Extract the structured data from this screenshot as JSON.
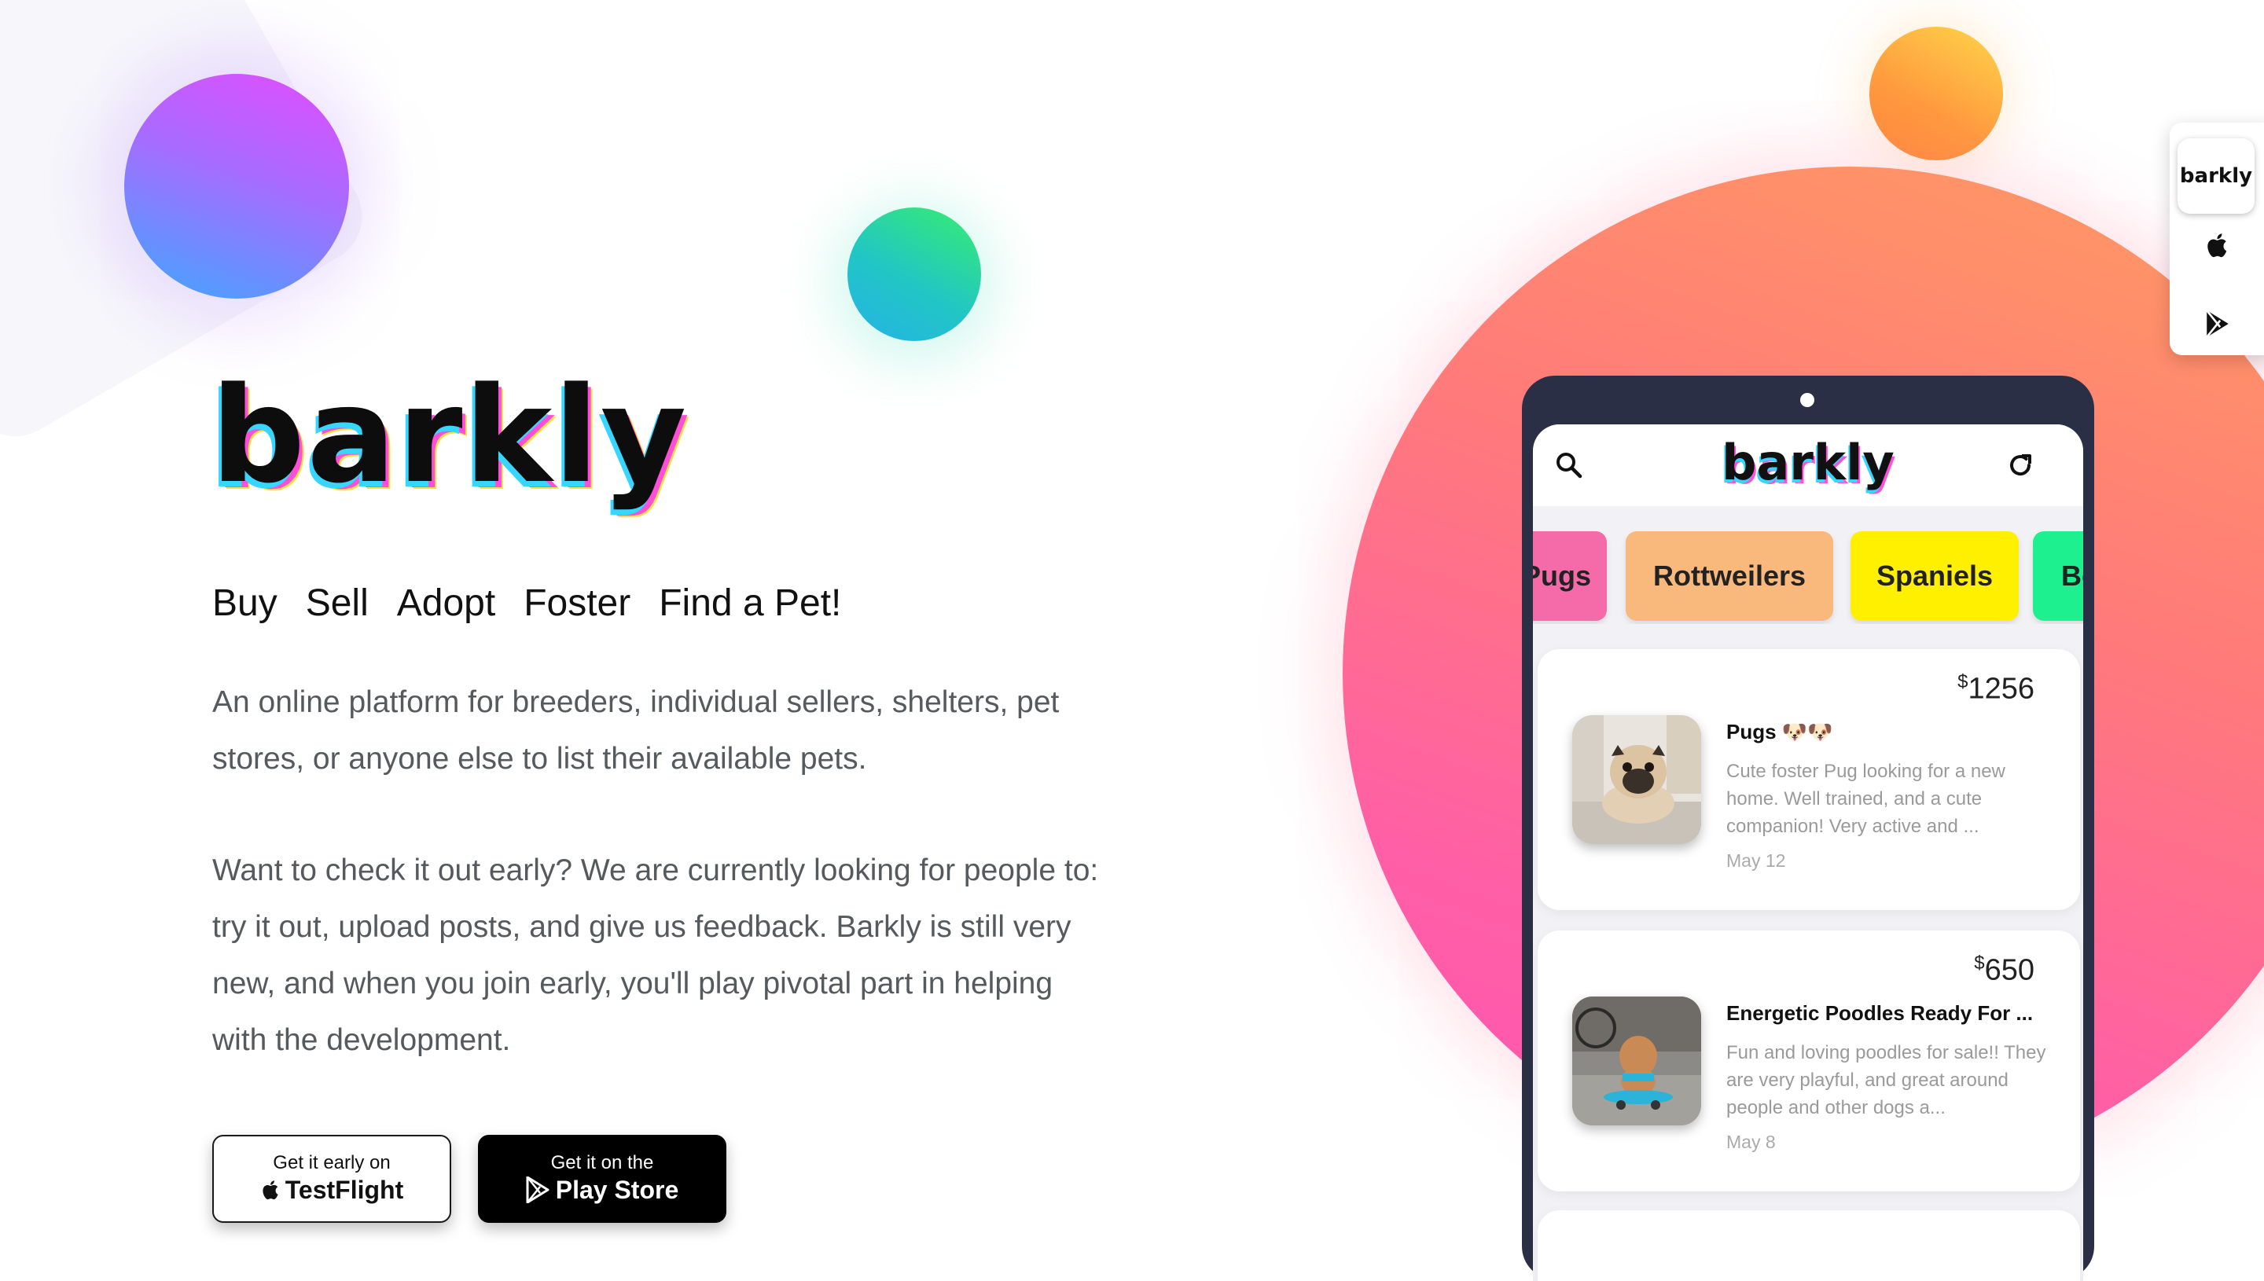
{
  "brand": {
    "logo_text": "barkly"
  },
  "nav": {
    "items": [
      "Buy",
      "Sell",
      "Adopt",
      "Foster",
      "Find a Pet!"
    ]
  },
  "description": {
    "paragraph1": "An online platform for breeders, individual sellers, shelters, pet stores, or anyone else to list their available pets.",
    "paragraph2": "Want to check it out early? We are currently looking for people to: try it out, upload posts, and give us feedback. Barkly is still very new, and when you join early, you'll play pivotal part in helping with the development."
  },
  "buttons": {
    "testflight": {
      "small": "Get it early on",
      "big": "TestFlight"
    },
    "playstore": {
      "small": "Get it on the",
      "big": "Play Store"
    }
  },
  "side_menu": {
    "logo_text": "barkly",
    "icons": [
      "apple-icon",
      "play-store-icon"
    ]
  },
  "app": {
    "title": "barkly",
    "header_icons": [
      "search-icon",
      "refresh-icon"
    ],
    "categories": [
      "Pugs",
      "Rottweilers",
      "Spaniels",
      "Bo"
    ],
    "listings": [
      {
        "price_symbol": "$",
        "price": "1256",
        "title": "Pugs 🐶🐶",
        "description": "Cute foster Pug looking for a new home. Well trained, and a cute companion! Very active and ...",
        "date": "May 12"
      },
      {
        "price_symbol": "$",
        "price": "650",
        "title": "Energetic Poodles Ready For ...",
        "description": "Fun and loving poodles for sale!! They are very playful, and great around people and other dogs a...",
        "date": "May 8"
      }
    ]
  },
  "colors": {
    "chip_pugs": "#f56aa8",
    "chip_rottweilers": "#f9b97d",
    "chip_spaniels": "#fff000",
    "chip_bo": "#1df08f",
    "phone_frame": "#2b2f45"
  }
}
